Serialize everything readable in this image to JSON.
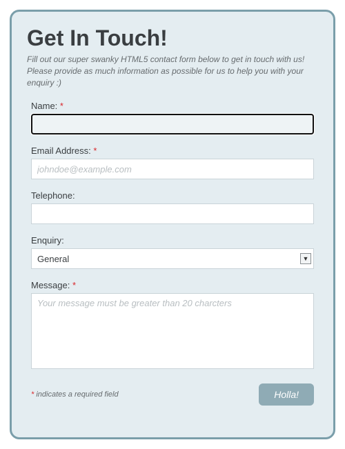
{
  "header": {
    "title": "Get In Touch!",
    "subtitle": "Fill out our super swanky HTML5 contact form below to get in touch with us! Please provide as much information as possible for us to help you with your enquiry :)"
  },
  "fields": {
    "name": {
      "label": "Name:",
      "required_mark": "*",
      "value": ""
    },
    "email": {
      "label": "Email Address:",
      "required_mark": "*",
      "placeholder": "johndoe@example.com",
      "value": ""
    },
    "telephone": {
      "label": "Telephone:",
      "value": ""
    },
    "enquiry": {
      "label": "Enquiry:",
      "selected": "General"
    },
    "message": {
      "label": "Message:",
      "required_mark": "*",
      "placeholder": "Your message must be greater than 20 charcters",
      "value": ""
    }
  },
  "footer": {
    "required_mark": "*",
    "required_text": " indicates a required field",
    "submit_label": "Holla!"
  }
}
